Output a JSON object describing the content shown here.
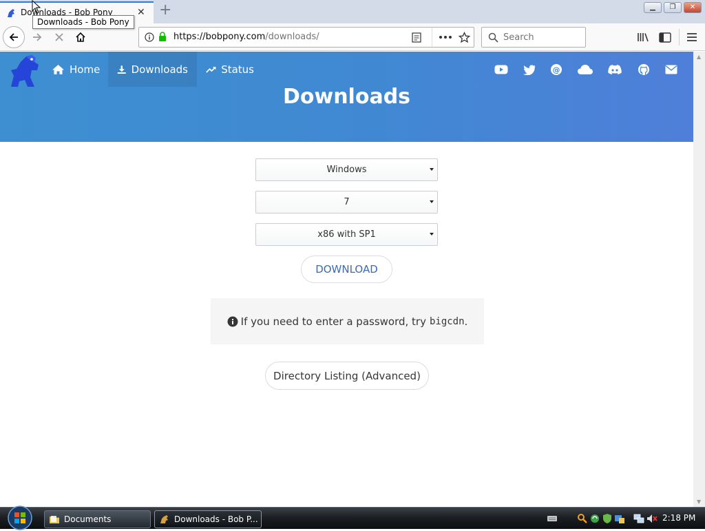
{
  "browser": {
    "tab_title": "Downloads - Bob Pony",
    "tooltip": "Downloads - Bob Pony",
    "url_host": "https://bobpony.com",
    "url_path": "/downloads/",
    "search_placeholder": "Search"
  },
  "site": {
    "nav": [
      {
        "label": "Home",
        "icon": "home-icon"
      },
      {
        "label": "Downloads",
        "icon": "download-icon"
      },
      {
        "label": "Status",
        "icon": "trending-up-icon"
      }
    ],
    "social_icons": [
      "youtube-icon",
      "twitter-icon",
      "mastodon-icon",
      "cloud-icon",
      "discord-icon",
      "github-icon",
      "email-icon"
    ],
    "page_title": "Downloads"
  },
  "form": {
    "os": "Windows",
    "version": "7",
    "edition": "x86 with SP1",
    "download_label": "DOWNLOAD"
  },
  "notice": {
    "text": "If you need to enter a password, try",
    "code": "bigcdn",
    "suffix": "."
  },
  "directory_label": "Directory Listing (Advanced)",
  "taskbar": {
    "items": [
      "Documents",
      "Downloads - Bob P..."
    ],
    "clock": "2:18 PM"
  },
  "colors": {
    "hero_start": "#3d8fd1",
    "hero_end": "#4f7fd9",
    "download_text": "#3a6bb3"
  }
}
